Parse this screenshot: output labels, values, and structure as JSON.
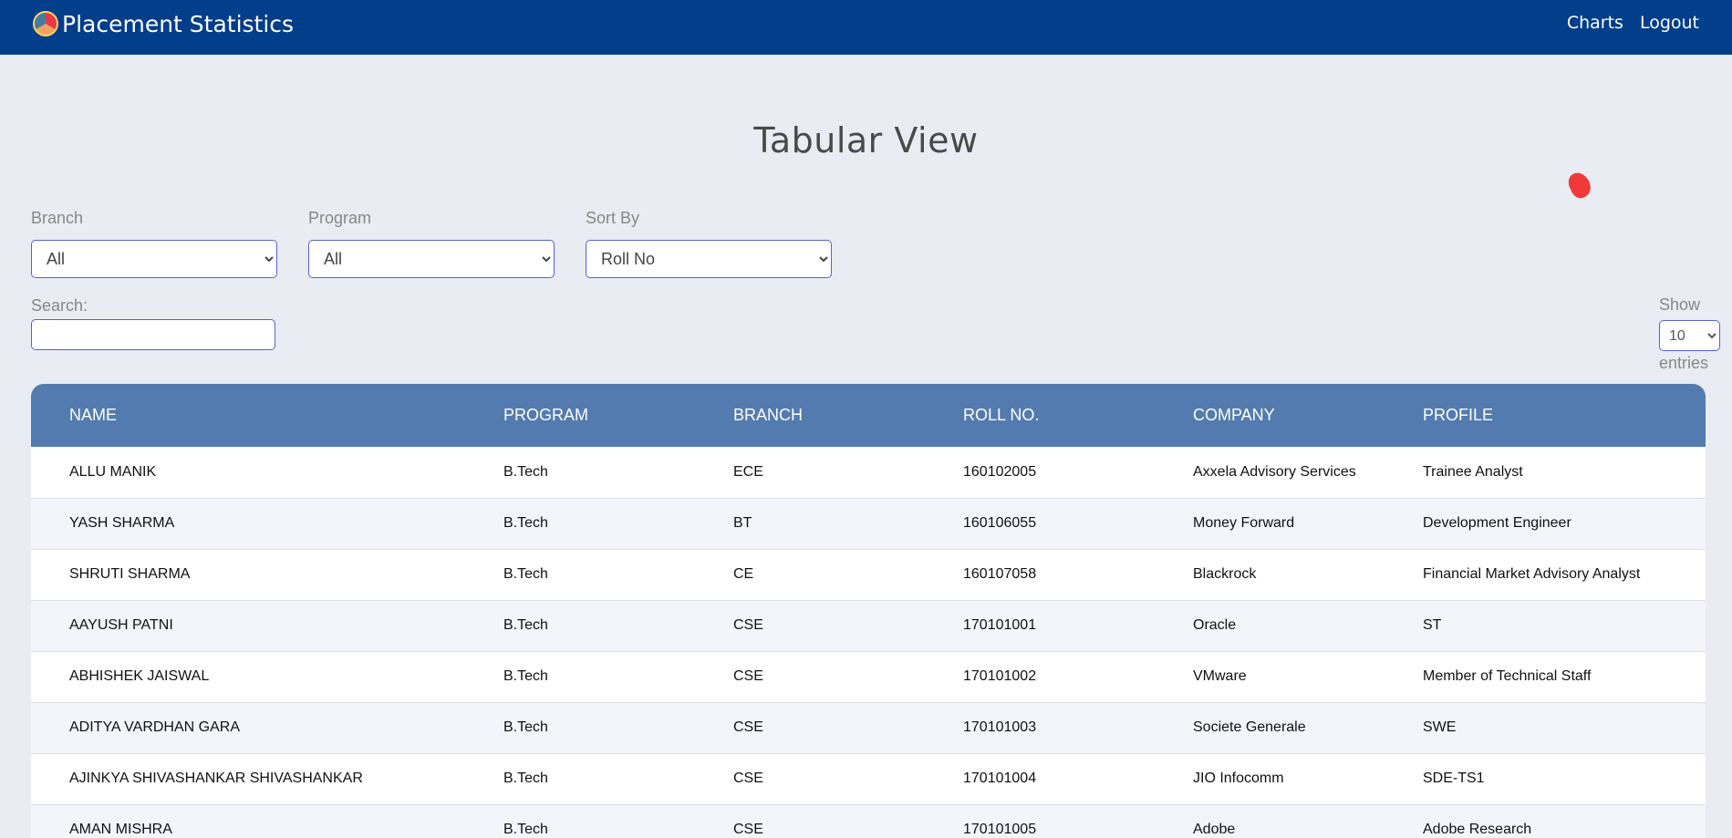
{
  "navbar": {
    "brand": "Placement Statistics",
    "logo_icon": "institute-logo-icon",
    "links": [
      "Charts",
      "Logout"
    ]
  },
  "page": {
    "title": "Tabular View"
  },
  "filters": {
    "branch": {
      "label": "Branch",
      "value": "All"
    },
    "program": {
      "label": "Program",
      "value": "All"
    },
    "sort_by": {
      "label": "Sort By",
      "value": "Roll No"
    }
  },
  "search": {
    "label": "Search:",
    "value": ""
  },
  "show_entries": {
    "label_top": "Show",
    "value": "10",
    "label_bottom": "entries"
  },
  "table": {
    "headers": [
      "NAME",
      "PROGRAM",
      "BRANCH",
      "ROLL NO.",
      "COMPANY",
      "PROFILE"
    ],
    "rows": [
      [
        "ALLU MANIK",
        "B.Tech",
        "ECE",
        "160102005",
        "Axxela Advisory Services",
        "Trainee Analyst"
      ],
      [
        "YASH SHARMA",
        "B.Tech",
        "BT",
        "160106055",
        "Money Forward",
        "Development Engineer"
      ],
      [
        "SHRUTI SHARMA",
        "B.Tech",
        "CE",
        "160107058",
        "Blackrock",
        "Financial Market Advisory Analyst"
      ],
      [
        "AAYUSH PATNI",
        "B.Tech",
        "CSE",
        "170101001",
        "Oracle",
        "ST"
      ],
      [
        "ABHISHEK JAISWAL",
        "B.Tech",
        "CSE",
        "170101002",
        "VMware",
        "Member of Technical Staff"
      ],
      [
        "ADITYA VARDHAN GARA",
        "B.Tech",
        "CSE",
        "170101003",
        "Societe Generale",
        "SWE"
      ],
      [
        "AJINKYA SHIVASHANKAR SHIVASHANKAR",
        "B.Tech",
        "CSE",
        "170101004",
        "JIO Infocomm",
        "SDE-TS1"
      ],
      [
        "AMAN MISHRA",
        "B.Tech",
        "CSE",
        "170101005",
        "Adobe",
        "Adobe Research"
      ]
    ]
  },
  "colors": {
    "navbar_bg": "#023e8a",
    "table_header_bg": "#537baf",
    "page_bg": "#e9ecf2",
    "select_border": "#5a5fd8"
  }
}
